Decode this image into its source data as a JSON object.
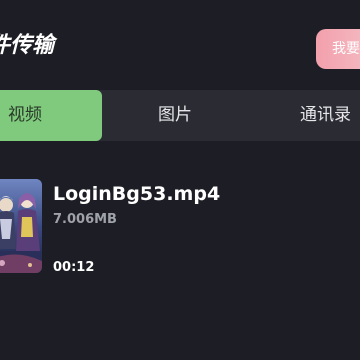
{
  "header": {
    "title": "件传输",
    "action_label": "我要"
  },
  "tabs": [
    {
      "label": "视频",
      "active": true
    },
    {
      "label": "图片",
      "active": false
    },
    {
      "label": "通讯录",
      "active": false
    }
  ],
  "files": [
    {
      "name": "LoginBg53.mp4",
      "size": "7.006MB",
      "duration": "00:12",
      "thumbnail": "anime-characters-thumbnail"
    }
  ],
  "colors": {
    "background": "#1d1e25",
    "tab_bar": "#2b2c33",
    "active_tab": "#7fca7c",
    "action_button": "#f2a0ac"
  }
}
